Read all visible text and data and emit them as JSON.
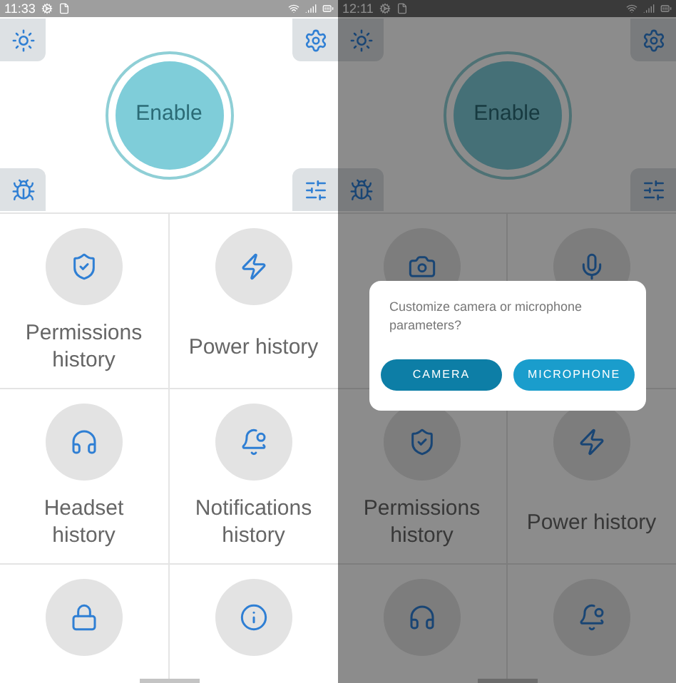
{
  "screens": [
    {
      "status_bar": {
        "time": "11:33"
      },
      "enable_button": "Enable",
      "tiles": [
        {
          "kind": "shield",
          "label": "Permissions history"
        },
        {
          "kind": "bolt",
          "label": "Power history"
        },
        {
          "kind": "headset",
          "label": "Headset history"
        },
        {
          "kind": "bell",
          "label": "Notifications history"
        },
        {
          "kind": "lock"
        },
        {
          "kind": "info"
        }
      ]
    },
    {
      "status_bar": {
        "time": "12:11"
      },
      "enable_button": "Enable",
      "tiles": [
        {
          "kind": "camera"
        },
        {
          "kind": "mic"
        },
        {
          "kind": "shield",
          "label": "Permissions history"
        },
        {
          "kind": "bolt",
          "label": "Power history"
        },
        {
          "kind": "headset"
        },
        {
          "kind": "bell"
        }
      ],
      "dialog": {
        "message": "Customize camera or microphone parameters?",
        "buttons": [
          {
            "label": "CAMERA",
            "kind": "primary"
          },
          {
            "label": "MICROPHONE",
            "kind": "secondary"
          }
        ]
      }
    }
  ]
}
